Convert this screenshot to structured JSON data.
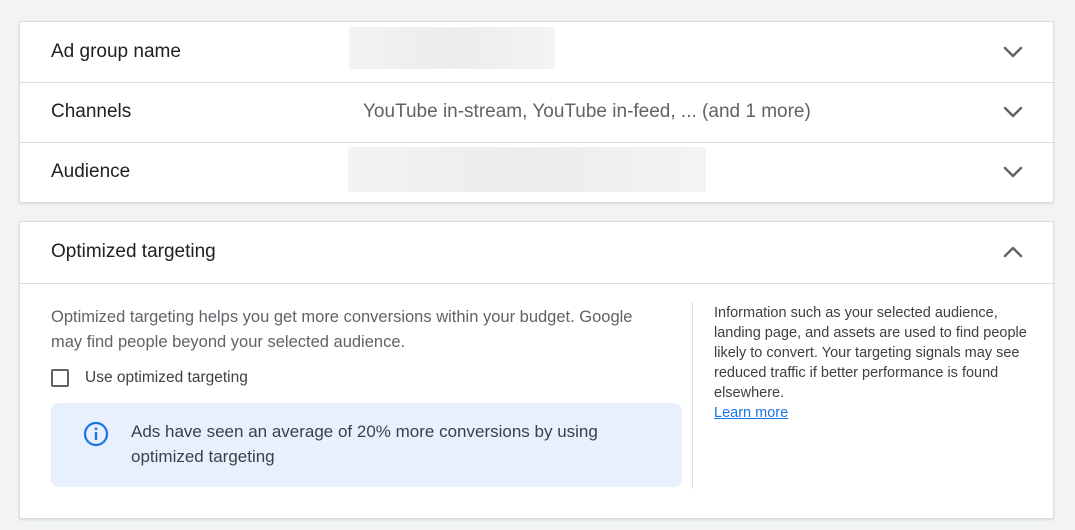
{
  "rows": [
    {
      "label": "Ad group name",
      "value": ""
    },
    {
      "label": "Channels",
      "value": "YouTube in-stream, YouTube in-feed, ... (and 1 more)"
    },
    {
      "label": "Audience",
      "value": ""
    }
  ],
  "icons": {
    "expand": "chevron-down-icon",
    "collapse": "chevron-up-icon",
    "info": "info-icon"
  },
  "optimized": {
    "title": "Optimized targeting",
    "description": "Optimized targeting helps you get more conversions within your budget. Google may find people beyond your selected audience.",
    "checkbox_label": "Use optimized targeting",
    "checkbox_checked": false,
    "info_text": "Ads have seen an average of 20% more conversions by using optimized targeting",
    "side_text": "Information such as your selected audience, landing page, and assets are used to find people likely to convert. Your targeting signals may see reduced traffic if better performance is found elsewhere.",
    "learn_more": "Learn more"
  },
  "colors": {
    "accent": "#1a73e8",
    "info_bg": "#e8f0fe",
    "text_primary": "#202124",
    "text_secondary": "#5f6368"
  }
}
